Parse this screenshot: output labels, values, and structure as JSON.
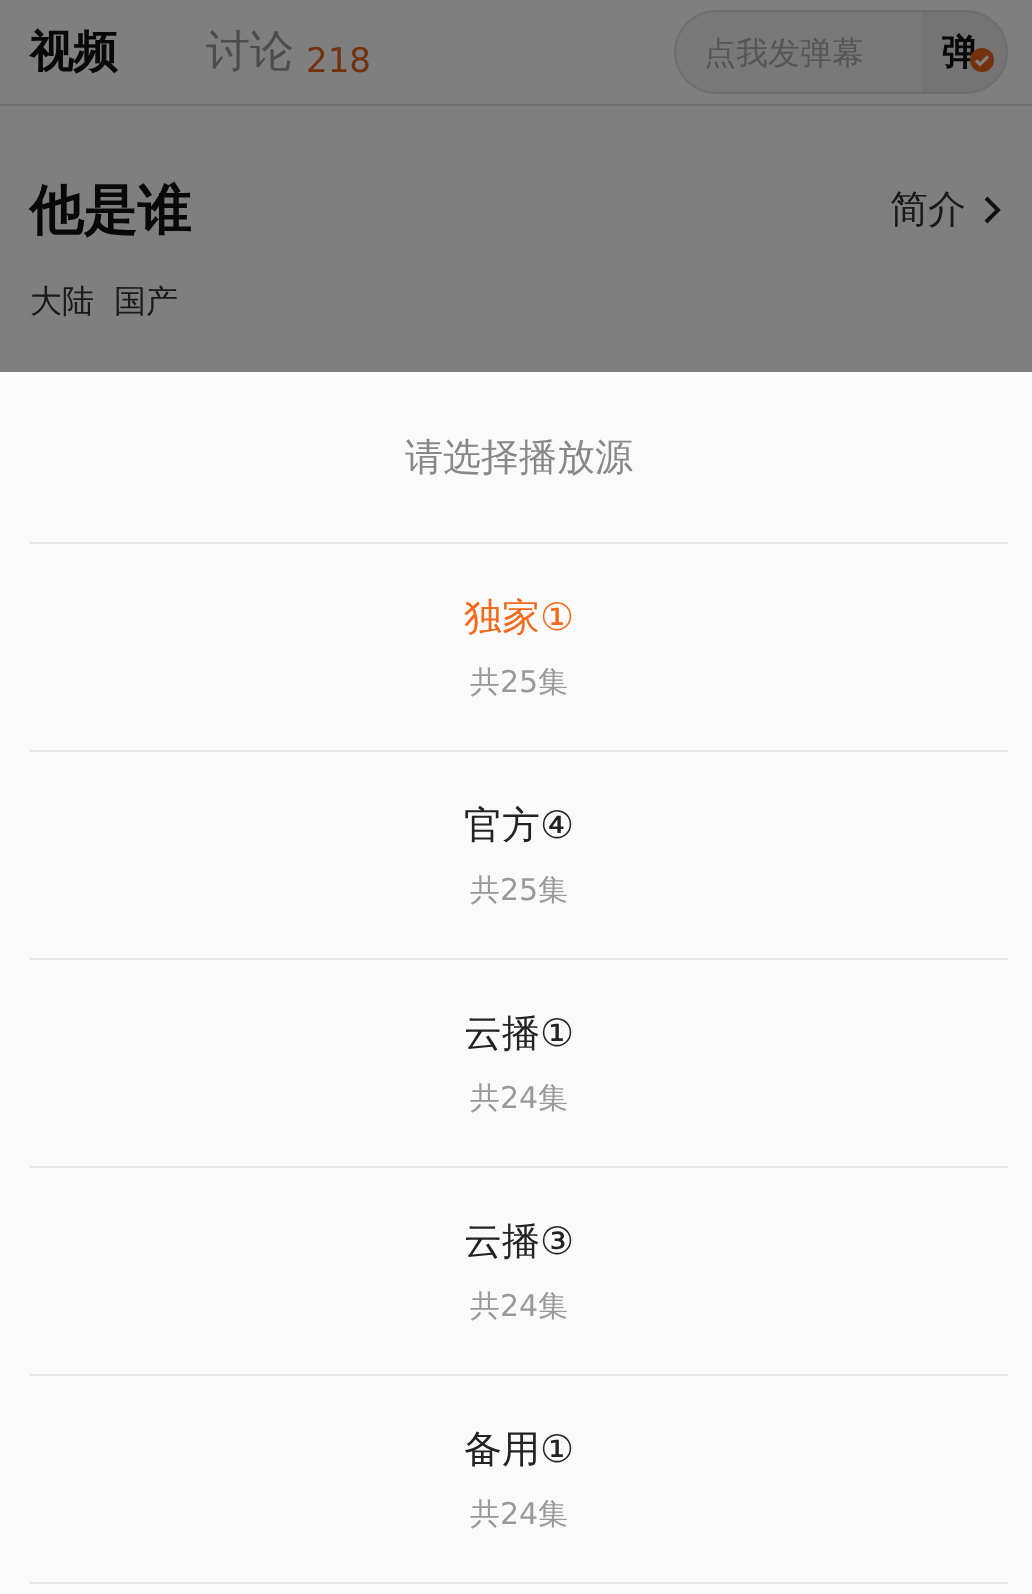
{
  "tabs": [
    {
      "label": "视频",
      "selected": true
    },
    {
      "label": "讨论",
      "selected": false,
      "count": "218"
    }
  ],
  "danmaku": {
    "placeholder": "点我发弹幕",
    "toggle": "弹",
    "on": true
  },
  "show": {
    "title": "他是谁",
    "intro_link": "简介",
    "tags": [
      "大陆",
      "国产"
    ]
  },
  "sheet": {
    "title": "请选择播放源",
    "sources": [
      {
        "name": "独家①",
        "episodes": "共25集",
        "selected": true
      },
      {
        "name": "官方④",
        "episodes": "共25集",
        "selected": false
      },
      {
        "name": "云播①",
        "episodes": "共24集",
        "selected": false
      },
      {
        "name": "云播③",
        "episodes": "共24集",
        "selected": false
      },
      {
        "name": "备用①",
        "episodes": "共24集",
        "selected": false
      }
    ]
  }
}
